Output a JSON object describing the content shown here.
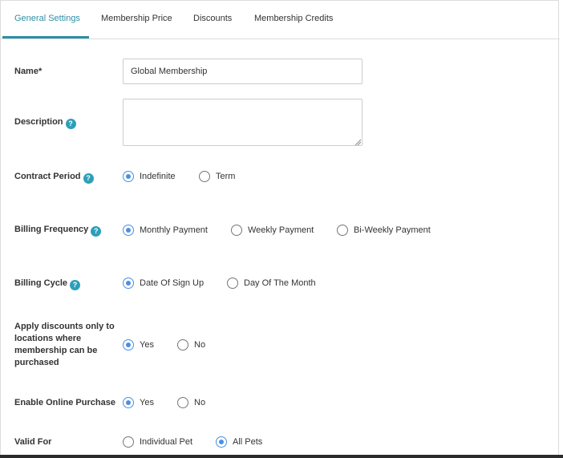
{
  "tabs": [
    {
      "label": "General Settings",
      "active": true
    },
    {
      "label": "Membership Price",
      "active": false
    },
    {
      "label": "Discounts",
      "active": false
    },
    {
      "label": "Membership Credits",
      "active": false
    }
  ],
  "help_glyph": "?",
  "fields": {
    "name": {
      "label": "Name*",
      "value": "Global Membership"
    },
    "description": {
      "label": "Description",
      "value": ""
    },
    "contract_period": {
      "label": "Contract Period",
      "options": [
        "Indefinite",
        "Term"
      ],
      "selected": "Indefinite"
    },
    "billing_frequency": {
      "label": "Billing Frequency",
      "options": [
        "Monthly Payment",
        "Weekly Payment",
        "Bi-Weekly Payment"
      ],
      "selected": "Monthly Payment"
    },
    "billing_cycle": {
      "label": "Billing Cycle",
      "options": [
        "Date Of Sign Up",
        "Day Of The Month"
      ],
      "selected": "Date Of Sign Up"
    },
    "apply_discounts": {
      "label": "Apply discounts only to locations where membership can be purchased",
      "options": [
        "Yes",
        "No"
      ],
      "selected": "Yes"
    },
    "enable_online_purchase": {
      "label": "Enable Online Purchase",
      "options": [
        "Yes",
        "No"
      ],
      "selected": "Yes"
    },
    "valid_for": {
      "label": "Valid For",
      "options": [
        "Individual Pet",
        "All Pets"
      ],
      "selected": "All Pets"
    }
  },
  "colors": {
    "accent": "#2d8fa5",
    "help_badge": "#2d9fb8",
    "radio_checked": "#4a90e2"
  }
}
